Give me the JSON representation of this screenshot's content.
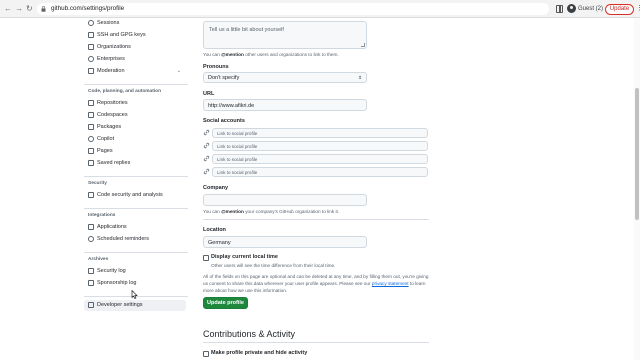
{
  "browser": {
    "url": "github.com/settings/profile",
    "profile_name": "Guest (2)",
    "update_label": "Update",
    "icons": [
      "back-arrow-icon",
      "forward-arrow-icon",
      "reload-icon",
      "lock-icon",
      "side-panel-icon",
      "guest-avatar-icon",
      "kebab-menu-icon"
    ]
  },
  "sidebar": {
    "groups": [
      {
        "items": [
          {
            "label": "Sessions",
            "icon": "broadcast-icon"
          },
          {
            "label": "SSH and GPG keys",
            "icon": "key-icon"
          },
          {
            "label": "Organizations",
            "icon": "organization-icon"
          },
          {
            "label": "Enterprises",
            "icon": "globe-icon"
          },
          {
            "label": "Moderation",
            "icon": "report-icon",
            "chevron": "⌄"
          }
        ]
      },
      {
        "heading": "Code, planning, and automation",
        "items": [
          {
            "label": "Repositories",
            "icon": "repo-icon"
          },
          {
            "label": "Codespaces",
            "icon": "codespaces-icon"
          },
          {
            "label": "Packages",
            "icon": "package-icon"
          },
          {
            "label": "Copilot",
            "icon": "copilot-icon"
          },
          {
            "label": "Pages",
            "icon": "browser-icon"
          },
          {
            "label": "Saved replies",
            "icon": "reply-icon"
          }
        ]
      },
      {
        "heading": "Security",
        "items": [
          {
            "label": "Code security and analysis",
            "icon": "codescan-icon"
          }
        ]
      },
      {
        "heading": "Integrations",
        "items": [
          {
            "label": "Applications",
            "icon": "apps-icon"
          },
          {
            "label": "Scheduled reminders",
            "icon": "clock-icon"
          }
        ]
      },
      {
        "heading": "Archives",
        "items": [
          {
            "label": "Security log",
            "icon": "log-icon"
          },
          {
            "label": "Sponsorship log",
            "icon": "log-icon"
          }
        ]
      },
      {
        "items": [
          {
            "label": "Developer settings",
            "icon": "code-icon",
            "selected": true
          }
        ]
      }
    ]
  },
  "profile_form": {
    "bio": {
      "placeholder": "Tell us a little bit about yourself",
      "note_prefix": "You can ",
      "note_mention": "@mention",
      "note_suffix": " other users and organizations to link to them."
    },
    "pronouns": {
      "label": "Pronouns",
      "value": "Don't specify",
      "arrow": "⇕"
    },
    "url": {
      "label": "URL",
      "value": "http://www.afikri.de"
    },
    "social_accounts": {
      "label": "Social accounts",
      "placeholders": [
        "Link to social profile",
        "Link to social profile",
        "Link to social profile",
        "Link to social profile"
      ]
    },
    "company": {
      "label": "Company",
      "value": "",
      "note_prefix": "You can ",
      "note_mention": "@mention",
      "note_suffix": " your company's GitHub organization to link it."
    },
    "location": {
      "label": "Location",
      "value": "Germany"
    },
    "local_time": {
      "label": "Display current local time",
      "checked": false,
      "note": "Other users will see the time difference from their local time."
    },
    "privacy": {
      "text_before": "All of the fields on this page are optional and can be deleted at any time, and by filling them out, you're giving us consent to share this data wherever your user profile appears. Please see our ",
      "link": "privacy statement",
      "text_after": " to learn more about how we use this information."
    },
    "submit_label": "Update profile"
  },
  "contributions": {
    "title": "Contributions & Activity",
    "private_label": "Make profile private and hide activity",
    "private_checked": false
  },
  "colors": {
    "primary_button": "#1f883d",
    "link": "#0969da",
    "update_red": "#c5221f",
    "selected_nav_bg": "#eef0f3"
  }
}
